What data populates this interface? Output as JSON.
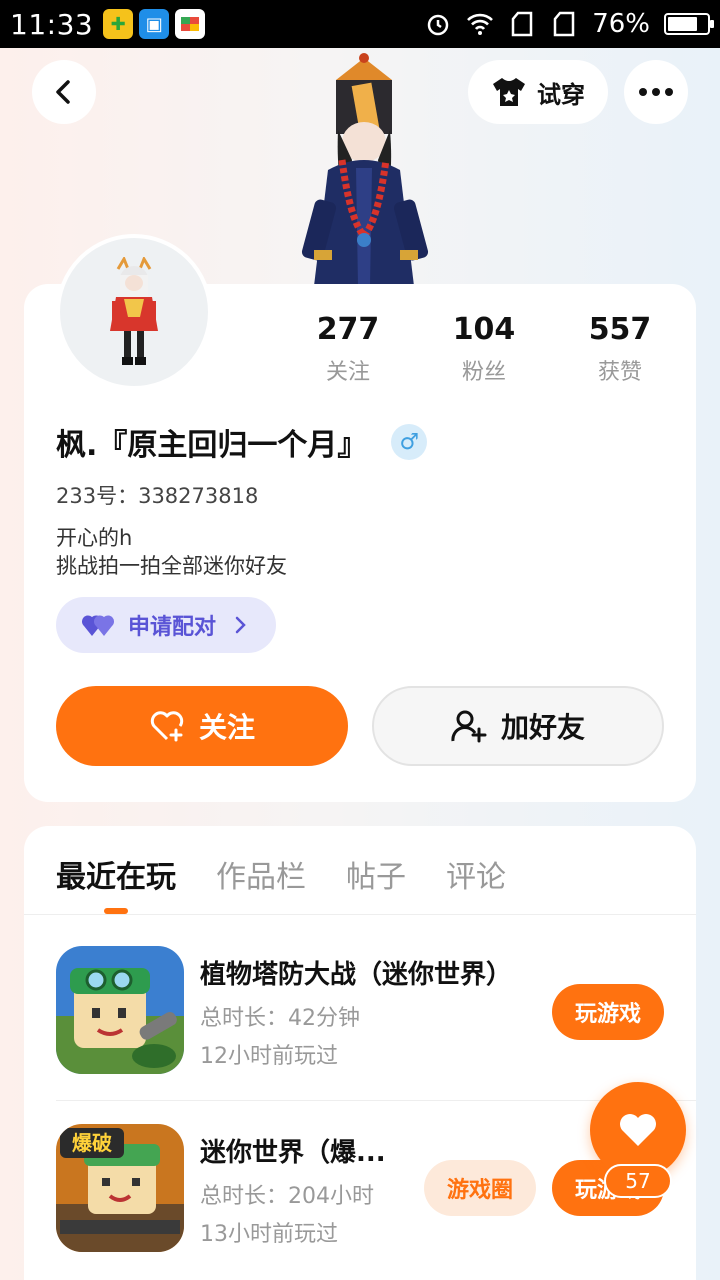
{
  "status_bar": {
    "time": "11:33",
    "battery_percent": "76%",
    "battery_level": 0.76
  },
  "header": {
    "try_on_label": "试穿",
    "back_icon": "chevron-left-icon",
    "more_icon": "more-dots-icon"
  },
  "profile": {
    "stats": [
      {
        "value": "277",
        "label": "关注"
      },
      {
        "value": "104",
        "label": "粉丝"
      },
      {
        "value": "557",
        "label": "获赞"
      }
    ],
    "username": "枫.『原主回归一个月』",
    "gender_symbol": "♂",
    "uid": "233号：338273818",
    "bio_line1": "开心的h",
    "bio_line2": "挑战拍一拍全部迷你好友",
    "match_label": "申请配对",
    "follow_label": "关注",
    "add_friend_label": "加好友"
  },
  "tabs": [
    {
      "label": "最近在玩",
      "active": true
    },
    {
      "label": "作品栏",
      "active": false
    },
    {
      "label": "帖子",
      "active": false
    },
    {
      "label": "评论",
      "active": false
    }
  ],
  "games": [
    {
      "title": "植物塔防大战（迷你世界）",
      "duration": "总时长：42分钟",
      "last_played": "12小时前玩过",
      "play_label": "玩游戏"
    },
    {
      "title": "迷你世界（爆...",
      "duration": "总时长：204小时",
      "last_played": "13小时前玩过",
      "circle_label": "游戏圈",
      "play_label": "玩游戏",
      "icon_badge": "爆破"
    }
  ],
  "like": {
    "count": "57"
  },
  "colors": {
    "accent": "#ff7210",
    "match_bg": "#e7e8fb",
    "match_text": "#5a54d6",
    "gender_blue": "#3f9fe0"
  }
}
